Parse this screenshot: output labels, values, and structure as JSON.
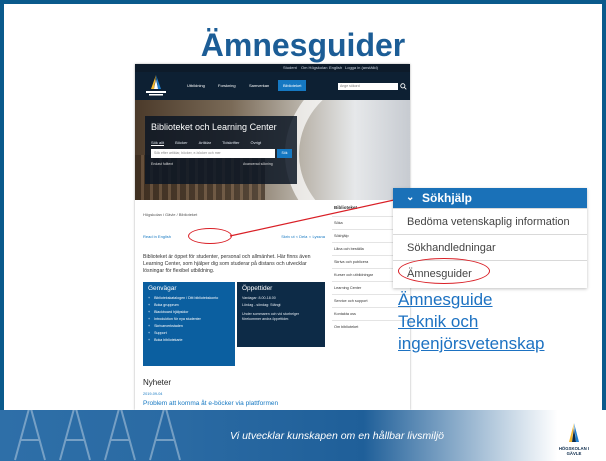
{
  "slide": {
    "title": "Ämnesguider",
    "footer_slogan": "Vi utvecklar kunskapen om en hållbar livsmiljö",
    "footer_logo_text": "HÖGSKOLAN I GÄVLE"
  },
  "website": {
    "top_links": [
      "Student",
      "Om Högskolan",
      "English",
      "Logga in (anställd)"
    ],
    "logo_text": "HÖGSKOLAN I GÄVLE",
    "nav_items": [
      "Utbildning",
      "Forskning",
      "Samverkan",
      "Biblioteket"
    ],
    "nav_active_index": 3,
    "nav_search_placeholder": "Ange sökord",
    "hero": {
      "heading": "Biblioteket och Learning Center",
      "search_tabs": [
        "Sök allt",
        "Böcker",
        "Artiklar",
        "Tidskrifter",
        "Övrigt"
      ],
      "search_placeholder": "Sök efter artiklar, böcker, e-böcker och mer",
      "search_button": "Sök",
      "limit_label": "Endast fulltext",
      "advanced_search": "Avancerad sökning"
    },
    "breadcrumb": "Högskolan i Gävle / Biblioteket",
    "read_in_english": "Read in English",
    "tools": "Skriv ut  <  Dela  ∩ Lyssna",
    "intro_text": "Biblioteket är öppet för studenter, personal och allmänhet. Här finns även Learning Center, som hjälper dig som studerar på distans och utvecklar lösningar för flexibel utbildning.",
    "shortcuts": {
      "heading": "Genvägar",
      "items": [
        "Bibliotekskatalogen / Ditt bibliotekskonto",
        "Boka grupprum",
        "Blackboard hjälpsidor",
        "Introduktion för nya studenter",
        "Skrivarverkstaden",
        "Support",
        "Boka bibliotekarie"
      ]
    },
    "hours": {
      "heading": "Öppettider",
      "lines": [
        "Vardagar: 8.00-18.00",
        "Lördag - söndag: Stängt",
        "Under sommaren och vid storhelger",
        "förekommer andra öppettider."
      ]
    },
    "news": {
      "heading": "Nyheter",
      "date": "2019-09-04",
      "headline": "Problem att komma åt e-böcker via plattformen"
    },
    "side_nav": {
      "title": "Biblioteket",
      "items": [
        "Söka",
        "Sökhjälp",
        "Låna och beställa",
        "Skriva och publicera",
        "Kurser och utbildningar",
        "Learning Center",
        "Service och support",
        "Kontakta oss",
        "Om biblioteket"
      ]
    }
  },
  "zoom_menu": {
    "header": "Sökhjälp",
    "items": [
      "Bedöma vetenskaplig information",
      "Sökhandledningar",
      "Ämnesguider"
    ]
  },
  "guide_link": [
    "Ämnesguide",
    "Teknik och",
    "ingenjörsvetenskap"
  ],
  "colors": {
    "title_blue": "#1c5d96",
    "menu_header": "#1a71b8",
    "highlight_ring": "#d91f26",
    "link_blue": "#1d72c2"
  }
}
